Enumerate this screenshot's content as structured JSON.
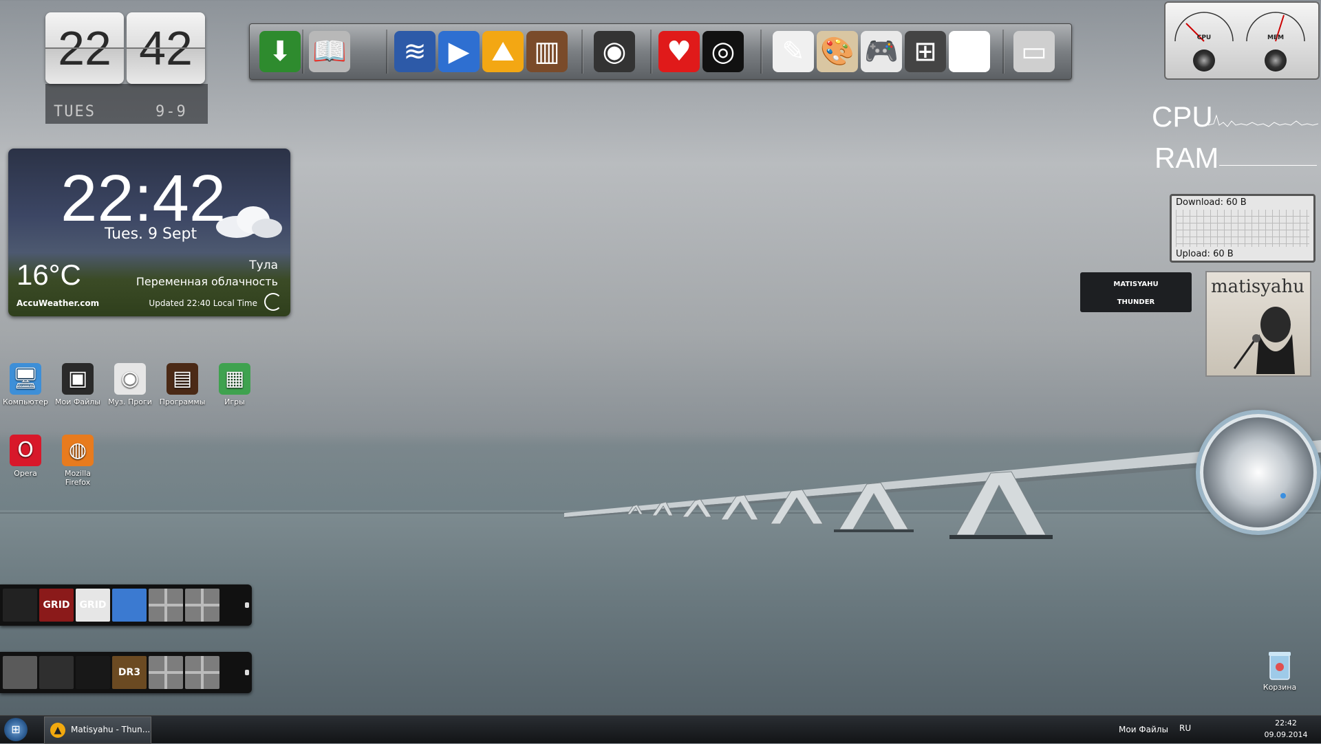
{
  "flip_clock": {
    "hours": "22",
    "minutes": "42",
    "day": "TUES",
    "date": "9-9"
  },
  "weather": {
    "time": "22:42",
    "date": "Tues. 9 Sept",
    "temperature": "16°C",
    "city": "Тула",
    "condition": "Переменная облачность",
    "provider": "AccuWeather.com",
    "updated": "Updated 22:40 Local Time"
  },
  "dock": {
    "icons": [
      {
        "name": "download-arrow-icon",
        "glyph": "⬇",
        "color": "#2e8b2e"
      },
      {
        "name": "book-icon",
        "glyph": "📖",
        "color": "#b8b8b8"
      },
      {
        "name": "audio-wave-icon",
        "glyph": "≋",
        "color": "#2d5aa8"
      },
      {
        "name": "video-player-icon",
        "glyph": "▶",
        "color": "#2e6fd1"
      },
      {
        "name": "photo-landscape-icon",
        "glyph": "⛰",
        "color": "#f3a713"
      },
      {
        "name": "library-books-icon",
        "glyph": "▥",
        "color": "#7a4b2a"
      },
      {
        "name": "speaker-icon",
        "glyph": "◉",
        "color": "#333333"
      },
      {
        "name": "heart-icon",
        "glyph": "♥",
        "color": "#e01a1a"
      },
      {
        "name": "camera-icon",
        "glyph": "◎",
        "color": "#111111"
      },
      {
        "name": "document-icon",
        "glyph": "✎",
        "color": "#f0f0f0"
      },
      {
        "name": "paint-palette-icon",
        "glyph": "🎨",
        "color": "#d9c6a2"
      },
      {
        "name": "gamepad-icon",
        "glyph": "🎮",
        "color": "#e9e9e9"
      },
      {
        "name": "mixer-sliders-icon",
        "glyph": "⊞",
        "color": "#444444"
      },
      {
        "name": "clock-icon",
        "glyph": "◷",
        "color": "#ffffff"
      },
      {
        "name": "monitor-apple-icon",
        "glyph": "▭",
        "color": "#cfcfcf"
      }
    ]
  },
  "desktop_icons": [
    {
      "name": "computer",
      "label": "Компьютер",
      "glyph": "🖥",
      "color": "#3d8fd8"
    },
    {
      "name": "my-files",
      "label": "Мои Файлы",
      "glyph": "▣",
      "color": "#2a2a2a"
    },
    {
      "name": "music-progs",
      "label": "Муз. Проги",
      "glyph": "◉",
      "color": "#e6e6e6"
    },
    {
      "name": "programs",
      "label": "Программы",
      "glyph": "▤",
      "color": "#4b2a16"
    },
    {
      "name": "games",
      "label": "Игры",
      "glyph": "▦",
      "color": "#3fa24f"
    },
    {
      "name": "opera",
      "label": "Opera",
      "glyph": "O",
      "color": "#d8182a"
    },
    {
      "name": "firefox",
      "label": "Mozilla Firefox",
      "glyph": "◍",
      "color": "#e87b1e"
    }
  ],
  "launcher_1": {
    "tiles": [
      {
        "name": "tile-need-for-speed",
        "label": "",
        "color": "#222222"
      },
      {
        "name": "tile-grid-1",
        "label": "GRID",
        "color": "#8b1a1a"
      },
      {
        "name": "tile-grid-autosport",
        "label": "GRID",
        "color": "#e6e6e6"
      },
      {
        "name": "tile-trials",
        "label": "",
        "color": "#3b7ad1"
      },
      {
        "name": "tile-empty-1",
        "label": "",
        "color": "empty"
      },
      {
        "name": "tile-empty-2",
        "label": "",
        "color": "empty"
      }
    ]
  },
  "launcher_2": {
    "tiles": [
      {
        "name": "tile-game-1",
        "label": "",
        "color": "#5a5a5a"
      },
      {
        "name": "tile-call-of-duty",
        "label": "",
        "color": "#2f2f2f"
      },
      {
        "name": "tile-ghost",
        "label": "",
        "color": "#181818"
      },
      {
        "name": "tile-dr3",
        "label": "DR3",
        "color": "#6b4a22"
      },
      {
        "name": "tile-empty-3",
        "label": "",
        "color": "empty"
      },
      {
        "name": "tile-empty-4",
        "label": "",
        "color": "empty"
      }
    ]
  },
  "system_monitor": {
    "cpu_label": "CPU",
    "mem_label": "MEM",
    "cpu_text": "CPU",
    "ram_text": "RAM"
  },
  "network": {
    "download": "Download: 60 B",
    "upload": "Upload: 60 B"
  },
  "music": {
    "artist": "MATISYAHU",
    "track": "THUNDER",
    "album_art_text": "matisyahu"
  },
  "recycle_bin": {
    "label": "Корзина"
  },
  "taskbar": {
    "start_glyph": "⊞",
    "task_title": "Matisyahu - Thun...",
    "tray_files": "Мои Файлы",
    "language": "RU",
    "time": "22:42",
    "date": "09.09.2014"
  }
}
